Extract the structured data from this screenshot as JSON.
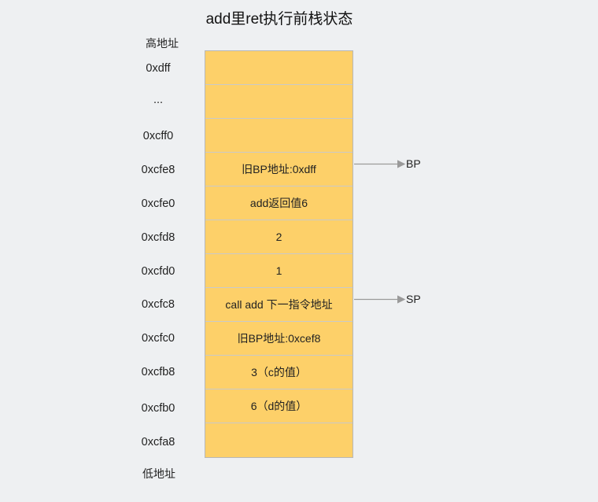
{
  "title": "add里ret执行前栈状态",
  "high_address_label": "高地址",
  "low_address_label": "低地址",
  "colors": {
    "stack_fill": "#fdd069",
    "arrow": "#9a9a9a",
    "background": "#eef0f2"
  },
  "rows": [
    {
      "address": "0xdff",
      "content": ""
    },
    {
      "address": "...",
      "content": ""
    },
    {
      "address": "0xcff0",
      "content": ""
    },
    {
      "address": "0xcfe8",
      "content": "旧BP地址:0xdff"
    },
    {
      "address": "0xcfe0",
      "content": "add返回值6"
    },
    {
      "address": "0xcfd8",
      "content": "2"
    },
    {
      "address": "0xcfd0",
      "content": "1"
    },
    {
      "address": "0xcfc8",
      "content": "call add 下一指令地址"
    },
    {
      "address": "0xcfc0",
      "content": "旧BP地址:0xcef8"
    },
    {
      "address": "0xcfb8",
      "content": "3（c的值）"
    },
    {
      "address": "0xcfb0",
      "content": "6（d的值）"
    },
    {
      "address": "0xcfa8",
      "content": ""
    }
  ],
  "pointers": [
    {
      "name": "BP",
      "row": 3
    },
    {
      "name": "SP",
      "row": 7
    }
  ]
}
